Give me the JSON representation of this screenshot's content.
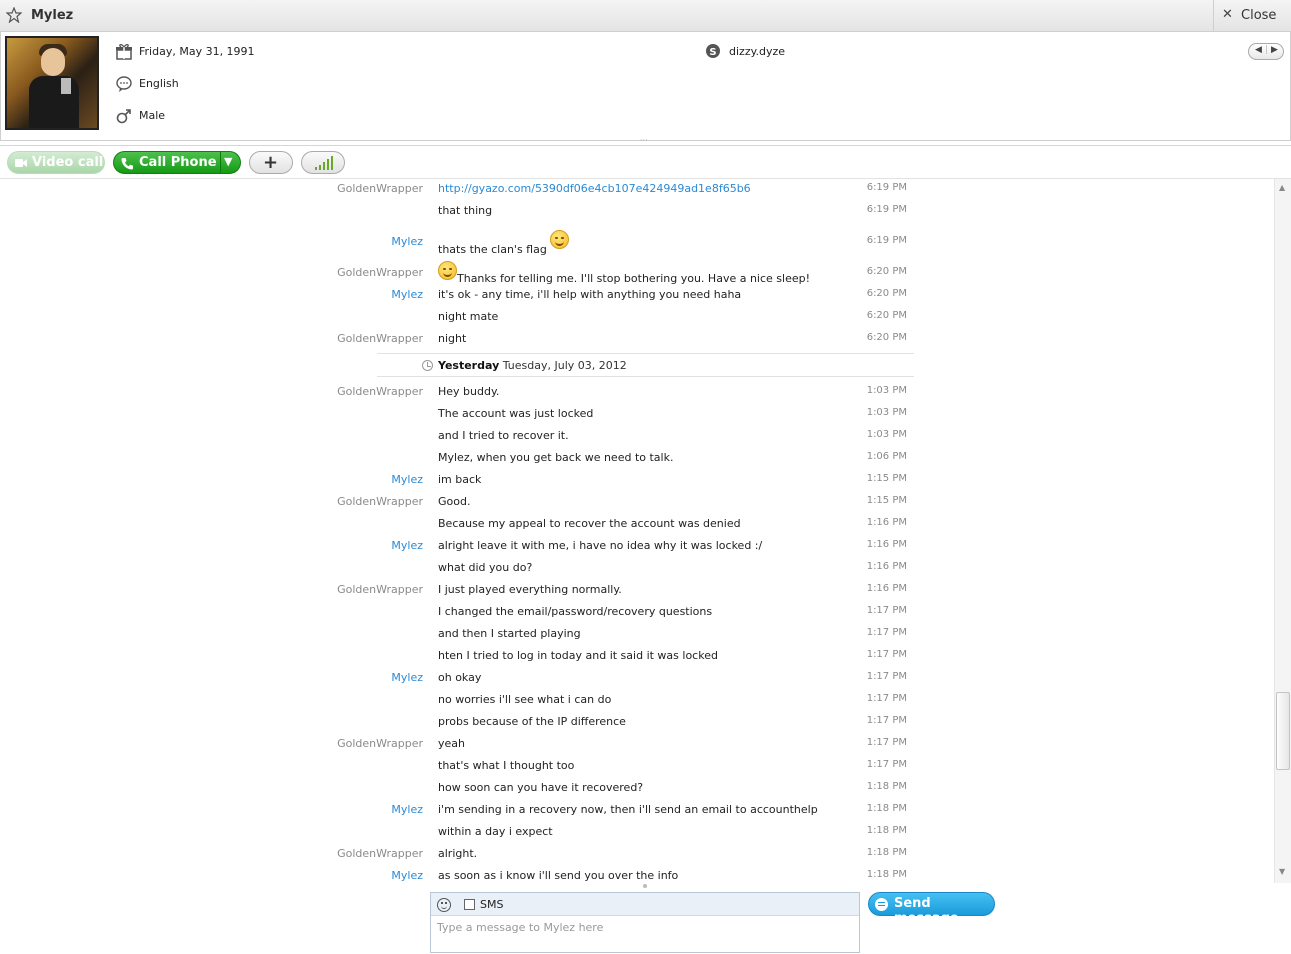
{
  "title": {
    "name": "Mylez",
    "close_label": "Close"
  },
  "profile": {
    "birthday": "Friday, May 31, 1991",
    "language": "English",
    "gender": "Male",
    "skype_name": "dizzy.dyze"
  },
  "toolbar": {
    "video_call": "Video call",
    "call_phone": "Call Phone"
  },
  "day_separator": {
    "bold": "Yesterday",
    "date": "Tuesday, July 03, 2012"
  },
  "messages_before": [
    {
      "sender": "GoldenWrapper",
      "text": "http://gyazo.com/5390df06e4cb107e424949ad1e8f65b6",
      "time": "6:19 PM"
    },
    {
      "sender": "",
      "text": "that thing",
      "time": "6:19 PM"
    },
    {
      "sender": "Mylez",
      "text": "thats the clan's flag",
      "time": "6:19 PM"
    },
    {
      "sender": "GoldenWrapper",
      "text": "Thanks for telling me. I'll stop bothering you. Have a nice sleep!",
      "time": "6:20 PM"
    },
    {
      "sender": "Mylez",
      "text": "it's ok - any time, i'll help with anything you need haha",
      "time": "6:20 PM"
    },
    {
      "sender": "",
      "text": "night mate",
      "time": "6:20 PM"
    },
    {
      "sender": "GoldenWrapper",
      "text": "night",
      "time": "6:20 PM"
    }
  ],
  "messages_after": [
    {
      "sender": "GoldenWrapper",
      "text": "Hey buddy.",
      "time": "1:03 PM"
    },
    {
      "sender": "",
      "text": "The account was just locked",
      "time": "1:03 PM"
    },
    {
      "sender": "",
      "text": "and I tried to recover it.",
      "time": "1:03 PM"
    },
    {
      "sender": "",
      "text": "Mylez, when you get back we need to talk.",
      "time": "1:06 PM"
    },
    {
      "sender": "Mylez",
      "text": "im back",
      "time": "1:15 PM"
    },
    {
      "sender": "GoldenWrapper",
      "text": "Good.",
      "time": "1:15 PM"
    },
    {
      "sender": "",
      "text": "Because my appeal to recover the account was denied",
      "time": "1:16 PM"
    },
    {
      "sender": "Mylez",
      "text": "alright leave it with me, i have no idea why it was locked :/",
      "time": "1:16 PM"
    },
    {
      "sender": "",
      "text": "what did you do?",
      "time": "1:16 PM"
    },
    {
      "sender": "GoldenWrapper",
      "text": "I just played everything normally.",
      "time": "1:16 PM"
    },
    {
      "sender": "",
      "text": "I changed the email/password/recovery questions",
      "time": "1:17 PM"
    },
    {
      "sender": "",
      "text": "and then I started playing",
      "time": "1:17 PM"
    },
    {
      "sender": "",
      "text": "hten I tried to log in today and it said it was locked",
      "time": "1:17 PM"
    },
    {
      "sender": "Mylez",
      "text": "oh okay",
      "time": "1:17 PM"
    },
    {
      "sender": "",
      "text": "no worries i'll see what i can do",
      "time": "1:17 PM"
    },
    {
      "sender": "",
      "text": "probs because of the IP difference",
      "time": "1:17 PM"
    },
    {
      "sender": "GoldenWrapper",
      "text": "yeah",
      "time": "1:17 PM"
    },
    {
      "sender": "",
      "text": "that's what I thought too",
      "time": "1:17 PM"
    },
    {
      "sender": "",
      "text": "how soon can you have it recovered?",
      "time": "1:18 PM"
    },
    {
      "sender": "Mylez",
      "text": "i'm sending in a recovery now, then i'll send an email to accounthelp",
      "time": "1:18 PM"
    },
    {
      "sender": "",
      "text": "within a day i expect",
      "time": "1:18 PM"
    },
    {
      "sender": "GoldenWrapper",
      "text": "alright.",
      "time": "1:18 PM"
    },
    {
      "sender": "Mylez",
      "text": "as soon as i know i'll send you over the info",
      "time": "1:18 PM"
    }
  ],
  "composer": {
    "sms_label": "SMS",
    "placeholder": "Type a message to Mylez here",
    "send_label": "Send message"
  },
  "colors": {
    "accent_blue": "#2a8ad6",
    "call_green": "#159a15",
    "send_blue": "#1a9bdc"
  },
  "icons": [
    "star-icon",
    "close-icon",
    "birthday-icon",
    "language-icon",
    "gender-icon",
    "skype-icon",
    "video-icon",
    "phone-icon",
    "plus-icon",
    "signal-icon",
    "clock-icon",
    "emoticon-icon",
    "send-icon"
  ]
}
